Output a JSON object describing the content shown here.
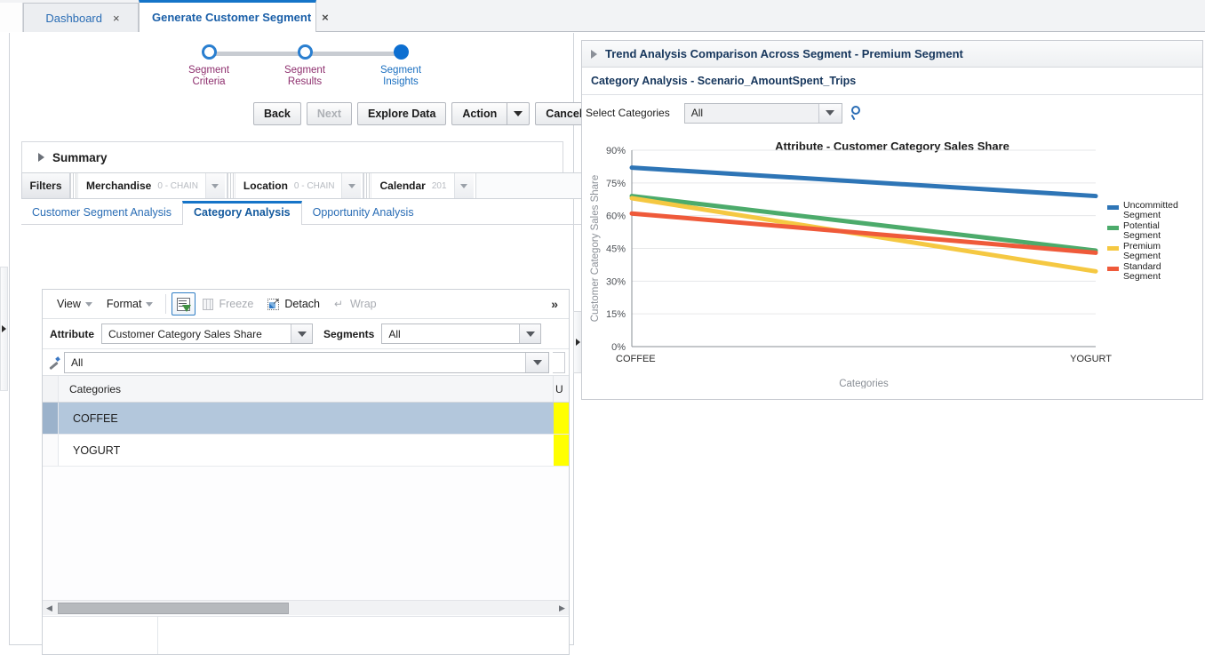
{
  "browser_tabs": [
    {
      "label": "Dashboard",
      "close": "×",
      "active": false
    },
    {
      "label": "Generate Customer Segment",
      "close": "×",
      "active": true
    }
  ],
  "train": {
    "steps": [
      {
        "line1": "Segment",
        "line2": "Criteria",
        "state": "done"
      },
      {
        "line1": "Segment",
        "line2": "Results",
        "state": "done"
      },
      {
        "line1": "Segment",
        "line2": "Insights",
        "state": "current"
      }
    ]
  },
  "actions": {
    "back": "Back",
    "next": "Next",
    "explore_data": "Explore Data",
    "action": "Action",
    "cancel": "Cancel"
  },
  "summary": {
    "title": "Summary"
  },
  "filters": {
    "label": "Filters",
    "items": [
      {
        "name": "Merchandise",
        "value": "0 - CHAIN"
      },
      {
        "name": "Location",
        "value": "0 - CHAIN"
      },
      {
        "name": "Calendar",
        "value": "201"
      }
    ]
  },
  "subtabs": [
    {
      "label": "Customer Segment Analysis",
      "active": false
    },
    {
      "label": "Category Analysis",
      "active": true
    },
    {
      "label": "Opportunity Analysis",
      "active": false
    }
  ],
  "table_toolbar": {
    "view": "View",
    "format": "Format",
    "freeze": "Freeze",
    "detach": "Detach",
    "wrap": "Wrap",
    "more": "»"
  },
  "table_controls": {
    "attribute_label": "Attribute",
    "attribute_value": "Customer Category Sales Share",
    "segments_label": "Segments",
    "segments_value": "All",
    "all_selector_value": "All"
  },
  "grid": {
    "columns": [
      "Categories",
      "U"
    ],
    "rows": [
      {
        "category": "COFFEE",
        "selected": true
      },
      {
        "category": "YOGURT",
        "selected": false
      }
    ]
  },
  "right_panel": {
    "header": "Trend Analysis Comparison Across Segment - Premium Segment",
    "subheader": "Category Analysis - Scenario_AmountSpent_Trips",
    "select_categories_label": "Select Categories",
    "select_categories_value": "All"
  },
  "colors": {
    "accent_blue": "#1574c8",
    "train_magenta": "#8e2f6e",
    "highlight_yellow": "#ffff00",
    "row_selected": "#b3c7dc",
    "uncommitted": "#2e75b6",
    "potential": "#4cab6b",
    "premium": "#f5c842",
    "standard": "#ef5a3a"
  },
  "chart_data": {
    "type": "line",
    "title": "Attribute - Customer Category Sales Share",
    "xlabel": "Categories",
    "ylabel": "Customer Category Sales Share",
    "categories": [
      "COFFEE",
      "YOGURT"
    ],
    "ylim": [
      0,
      90
    ],
    "yticks": [
      0,
      15,
      30,
      45,
      60,
      75,
      90
    ],
    "ytick_labels": [
      "0%",
      "15%",
      "30%",
      "45%",
      "60%",
      "75%",
      "90%"
    ],
    "grid": true,
    "legend_position": "right",
    "series": [
      {
        "name": "Uncommitted Segment",
        "color": "#2e75b6",
        "values": [
          82,
          69
        ]
      },
      {
        "name": "Potential Segment",
        "color": "#4cab6b",
        "values": [
          69,
          44
        ]
      },
      {
        "name": "Premium Segment",
        "color": "#f5c842",
        "values": [
          68,
          34.5
        ]
      },
      {
        "name": "Standard Segment",
        "color": "#ef5a3a",
        "values": [
          61,
          43
        ]
      }
    ]
  }
}
